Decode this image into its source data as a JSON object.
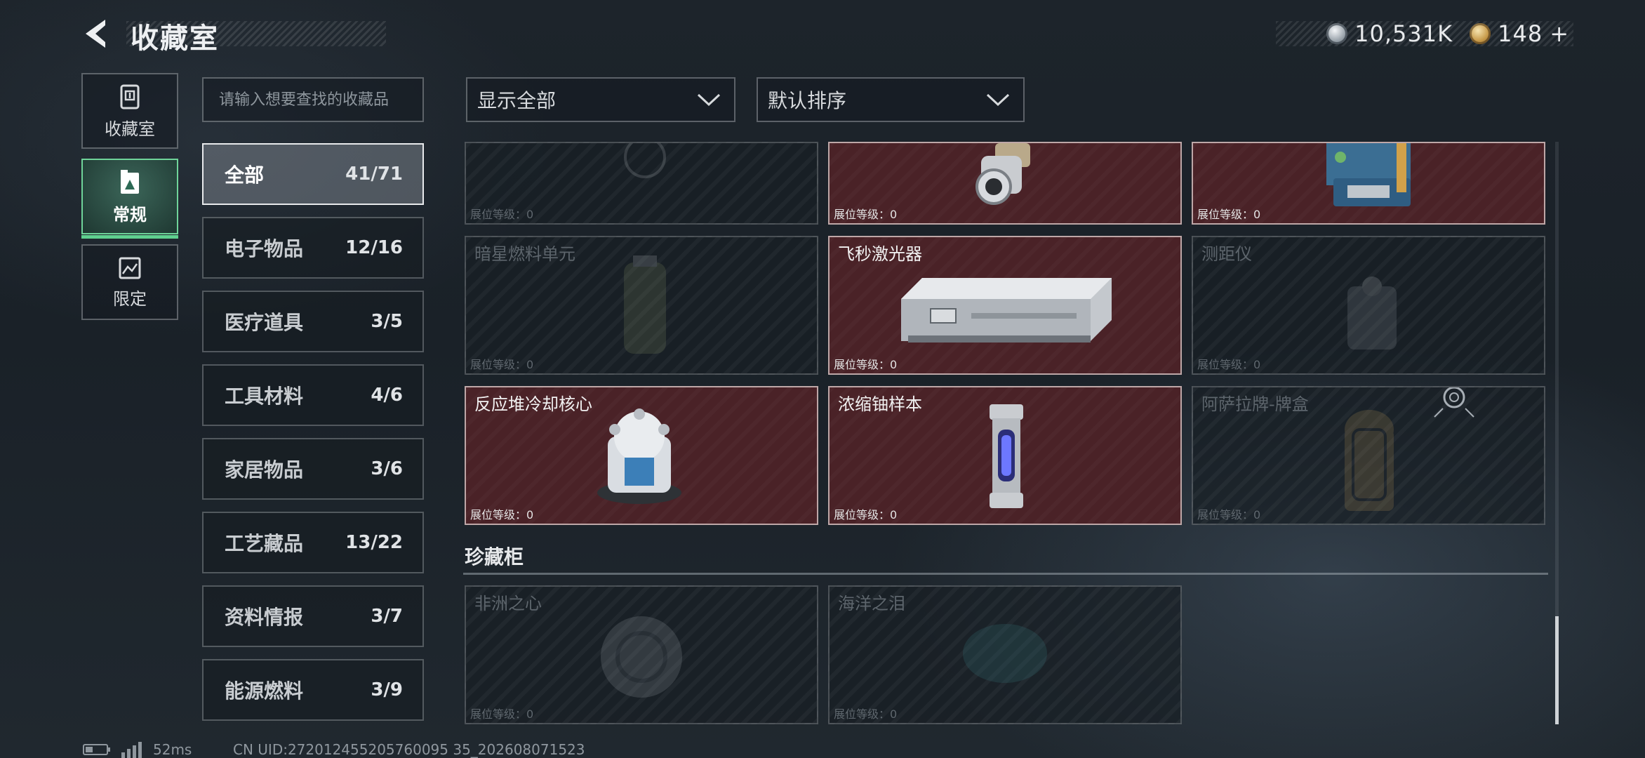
{
  "header": {
    "title": "收藏室"
  },
  "currency": {
    "silver": {
      "icon": "silver-coin-icon",
      "value": "10,531K"
    },
    "gold": {
      "icon": "gold-coin-icon",
      "value": "148",
      "plus": "+"
    }
  },
  "rail": [
    {
      "label": "收藏室",
      "icon": "vault-icon",
      "active": false
    },
    {
      "label": "常规",
      "icon": "collection-book-icon",
      "active": true
    },
    {
      "label": "限定",
      "icon": "limited-image-icon",
      "active": false
    }
  ],
  "search": {
    "placeholder": "请输入想要查找的收藏品"
  },
  "filters": {
    "display": "显示全部",
    "sort": "默认排序"
  },
  "categories": [
    {
      "name": "全部",
      "count": "41/71",
      "active": true
    },
    {
      "name": "电子物品",
      "count": "12/16"
    },
    {
      "name": "医疗道具",
      "count": "3/5"
    },
    {
      "name": "工具材料",
      "count": "4/6"
    },
    {
      "name": "家居物品",
      "count": "3/6"
    },
    {
      "name": "工艺藏品",
      "count": "13/22"
    },
    {
      "name": "资料情报",
      "count": "3/7"
    },
    {
      "name": "能源燃料",
      "count": "3/9"
    }
  ],
  "level_label": "展位等级：0",
  "items": [
    {
      "name": "",
      "owned": false
    },
    {
      "name": "",
      "owned": true
    },
    {
      "name": "",
      "owned": true
    },
    {
      "name": "暗星燃料单元",
      "owned": false
    },
    {
      "name": "飞秒激光器",
      "owned": true
    },
    {
      "name": "测距仪",
      "owned": false
    },
    {
      "name": "反应堆冷却核心",
      "owned": true
    },
    {
      "name": "浓缩铀样本",
      "owned": true
    },
    {
      "name": "阿萨拉牌-牌盒",
      "owned": false
    }
  ],
  "section": {
    "title": "珍藏柜"
  },
  "treasures": [
    {
      "name": "非洲之心",
      "owned": false
    },
    {
      "name": "海洋之泪",
      "owned": false
    }
  ],
  "status": {
    "ping": "52ms",
    "uid": "CN UID:272012455205760095 35_202608071523"
  },
  "colors": {
    "accent": "#5fd08f",
    "owned_card": "#4a2227",
    "background": "#1d242b"
  }
}
